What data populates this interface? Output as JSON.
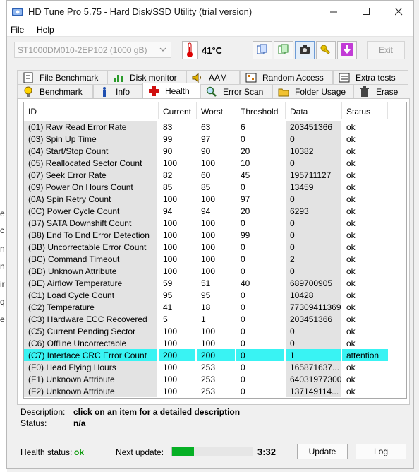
{
  "window": {
    "title": "HD Tune Pro 5.75 - Hard Disk/SSD Utility (trial version)"
  },
  "menu": [
    "File",
    "Help"
  ],
  "toolbar": {
    "drive": "ST1000DM010-2EP102 (1000 gB)",
    "temperature": "41°C",
    "exit_label": "Exit"
  },
  "tabs_top": [
    "File Benchmark",
    "Disk monitor",
    "AAM",
    "Random Access",
    "Extra tests"
  ],
  "tabs_bottom": [
    "Benchmark",
    "Info",
    "Health",
    "Error Scan",
    "Folder Usage",
    "Erase"
  ],
  "active_tab": "Health",
  "columns": [
    "ID",
    "Current",
    "Worst",
    "Threshold",
    "Data",
    "Status"
  ],
  "rows": [
    [
      "(01) Raw Read Error Rate",
      "83",
      "63",
      "6",
      "203451366",
      "ok"
    ],
    [
      "(03) Spin Up Time",
      "99",
      "97",
      "0",
      "0",
      "ok"
    ],
    [
      "(04) Start/Stop Count",
      "90",
      "90",
      "20",
      "10382",
      "ok"
    ],
    [
      "(05) Reallocated Sector Count",
      "100",
      "100",
      "10",
      "0",
      "ok"
    ],
    [
      "(07) Seek Error Rate",
      "82",
      "60",
      "45",
      "195711127",
      "ok"
    ],
    [
      "(09) Power On Hours Count",
      "85",
      "85",
      "0",
      "13459",
      "ok"
    ],
    [
      "(0A) Spin Retry Count",
      "100",
      "100",
      "97",
      "0",
      "ok"
    ],
    [
      "(0C) Power Cycle Count",
      "94",
      "94",
      "20",
      "6293",
      "ok"
    ],
    [
      "(B7) SATA Downshift Count",
      "100",
      "100",
      "0",
      "0",
      "ok"
    ],
    [
      "(B8) End To End Error Detection",
      "100",
      "100",
      "99",
      "0",
      "ok"
    ],
    [
      "(BB) Uncorrectable Error Count",
      "100",
      "100",
      "0",
      "0",
      "ok"
    ],
    [
      "(BC) Command Timeout",
      "100",
      "100",
      "0",
      "2",
      "ok"
    ],
    [
      "(BD) Unknown Attribute",
      "100",
      "100",
      "0",
      "0",
      "ok"
    ],
    [
      "(BE) Airflow Temperature",
      "59",
      "51",
      "40",
      "689700905",
      "ok"
    ],
    [
      "(C1) Load Cycle Count",
      "95",
      "95",
      "0",
      "10428",
      "ok"
    ],
    [
      "(C2) Temperature",
      "41",
      "18",
      "0",
      "77309411369",
      "ok"
    ],
    [
      "(C3) Hardware ECC Recovered",
      "5",
      "1",
      "0",
      "203451366",
      "ok"
    ],
    [
      "(C5) Current Pending Sector",
      "100",
      "100",
      "0",
      "0",
      "ok"
    ],
    [
      "(C6) Offline Uncorrectable",
      "100",
      "100",
      "0",
      "0",
      "ok"
    ],
    [
      "(C7) Interface CRC Error Count",
      "200",
      "200",
      "0",
      "1",
      "attention"
    ],
    [
      "(F0) Head Flying Hours",
      "100",
      "253",
      "0",
      "165871637...",
      "ok"
    ],
    [
      "(F1) Unknown Attribute",
      "100",
      "253",
      "0",
      "64031977300",
      "ok"
    ],
    [
      "(F2) Unknown Attribute",
      "100",
      "253",
      "0",
      "137149114...",
      "ok"
    ]
  ],
  "highlight_row": 19,
  "highlight_color": "#39f3f3",
  "bottom": {
    "description_label": "Description:",
    "description_value": "click on an item for a detailed description",
    "status_label": "Status:",
    "status_value": "n/a",
    "health_label": "Health status:",
    "health_value": "ok",
    "health_color": "#0a9a0a",
    "next_update_label": "Next update:",
    "next_update_time": "3:32",
    "progress_fraction": 0.27,
    "update_button": "Update",
    "log_button": "Log"
  },
  "background_fragments": [
    "e",
    "c",
    "n",
    "n",
    "ir",
    "q",
    "e"
  ]
}
